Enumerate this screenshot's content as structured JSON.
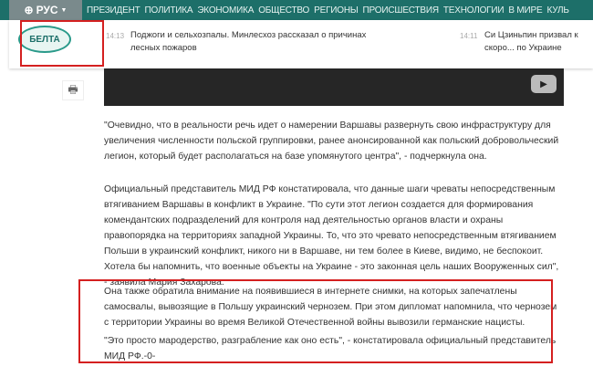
{
  "nav": {
    "language": "РУС",
    "items": [
      "ПРЕЗИДЕНТ",
      "ПОЛИТИКА",
      "ЭКОНОМИКА",
      "ОБЩЕСТВО",
      "РЕГИОНЫ",
      "ПРОИСШЕСТВИЯ",
      "ТЕХНОЛОГИИ",
      "В МИРЕ",
      "КУЛЬ"
    ]
  },
  "logo": "БЕЛТА",
  "ticker": [
    {
      "time": "14:13",
      "text": "Поджоги и сельхозпалы. Минлесхоз рассказал о причинах лесных пожаров"
    },
    {
      "time": "14:11",
      "text": "Си Цзиньпин призвал к скоро... по Украине"
    }
  ],
  "article": {
    "paragraphs": [
      "\"Очевидно, что в реальности речь идет о намерении Варшавы развернуть свою инфраструктуру для увеличения численности польской группировки, ранее анонсированной как польский добровольческий легион, который будет располагаться на базе упомянутого центра\", - подчеркнула она.",
      "Официальный представитель МИД РФ констатировала, что данные шаги чреваты непосредственным втягиванием Варшавы в конфликт в Украине. \"По сути этот легион создается для формирования комендантских подразделений для контроля над деятельностью органов власти и охраны правопорядка на территориях западной Украины. То, что это чревато непосредственным втягиванием Польши в украинский конфликт, никого ни в Варшаве, ни тем более в Киеве, видимо, не беспокоит. Хотела бы напомнить, что военные объекты на Украине - это законная цель наших Вооруженных сил\", - заявила Мария Захарова.",
      "Она также обратила внимание на появившиеся в интернете снимки, на которых запечатлены самосвалы, вывозящие в Польшу украинский чернозем. При этом дипломат напомнила, что чернозем с территории Украины во время Великой Отечественной войны вывозили германские нацисты.",
      "\"Это просто мародерство, разграбление как оно есть\", - констатировала официальный представитель МИД РФ.-0-"
    ]
  },
  "colors": {
    "nav": "#1d6f69",
    "highlight": "#d42020"
  }
}
